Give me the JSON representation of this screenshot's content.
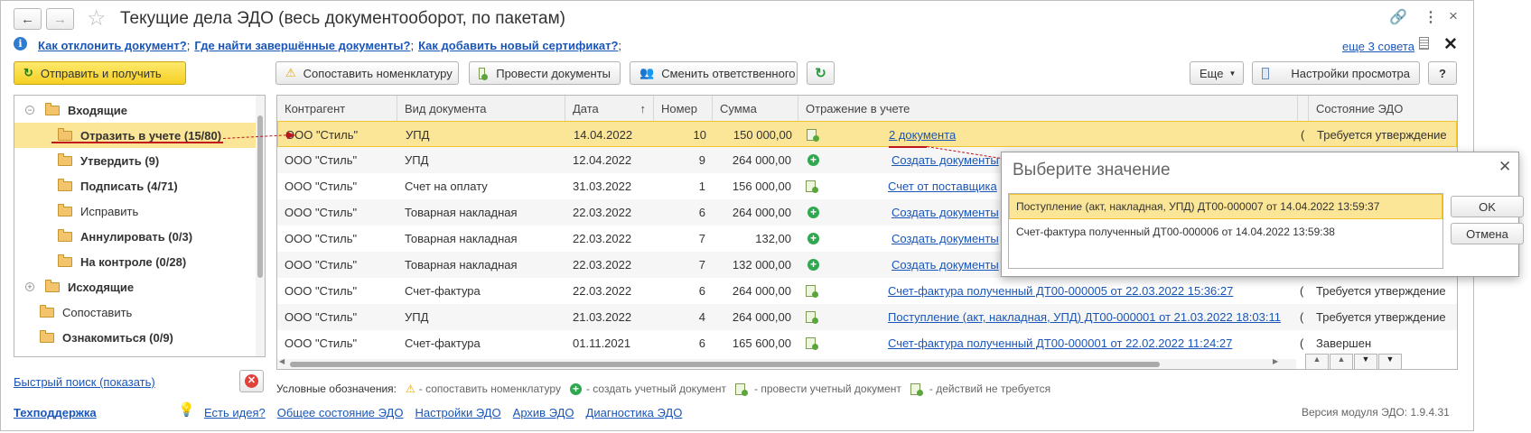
{
  "window": {
    "title": "Текущие дела ЭДО (весь документооборот, по пакетам)"
  },
  "help_links": [
    "Как отклонить документ?",
    "Где найти завершённые документы?",
    "Как добавить новый сертификат?"
  ],
  "help_separator": ";",
  "more_tips": "еще 3 совета",
  "toolbar": {
    "send_receive": "Отправить и получить",
    "match_nomenclature": "Сопоставить номенклатуру",
    "post_documents": "Провести документы",
    "change_responsible": "Сменить ответственного",
    "more": "Еще",
    "view_settings": "Настройки просмотра",
    "help": "?"
  },
  "tree": {
    "incoming": "Входящие",
    "items": [
      {
        "label": "Отразить в учете (15/80)",
        "bold": true
      },
      {
        "label": "Утвердить (9)",
        "bold": true
      },
      {
        "label": "Подписать (4/71)",
        "bold": true
      },
      {
        "label": "Исправить",
        "bold": false
      },
      {
        "label": "Аннулировать (0/3)",
        "bold": true
      },
      {
        "label": "На контроле (0/28)",
        "bold": true
      }
    ],
    "outgoing": "Исходящие",
    "match": "Сопоставить",
    "review": "Ознакомиться (0/9)"
  },
  "quick_search": "Быстрый поиск (показать)",
  "table": {
    "columns": [
      "Контрагент",
      "Вид документа",
      "Дата",
      "Номер",
      "Сумма",
      "Отражение в учете",
      "",
      "Состояние ЭДО"
    ],
    "sort_indicator": "↑",
    "rows": [
      {
        "counterparty": "ООО \"Стиль\"",
        "doc_type": "УПД",
        "date": "14.04.2022",
        "number": "10",
        "sum": "150 000,00",
        "icon": "doc",
        "accounting": "2 документа",
        "c": "(",
        "status": "Требуется утверждение"
      },
      {
        "counterparty": "ООО \"Стиль\"",
        "doc_type": "УПД",
        "date": "12.04.2022",
        "number": "9",
        "sum": "264 000,00",
        "icon": "plus",
        "accounting": "Создать документы",
        "c": "",
        "status": ""
      },
      {
        "counterparty": "ООО \"Стиль\"",
        "doc_type": "Счет на оплату",
        "date": "31.03.2022",
        "number": "1",
        "sum": "156 000,00",
        "icon": "doc",
        "accounting": "Счет от поставщика",
        "c": "",
        "status": ""
      },
      {
        "counterparty": "ООО \"Стиль\"",
        "doc_type": "Товарная накладная",
        "date": "22.03.2022",
        "number": "6",
        "sum": "264 000,00",
        "icon": "plus",
        "accounting": "Создать документы",
        "c": "",
        "status": ""
      },
      {
        "counterparty": "ООО \"Стиль\"",
        "doc_type": "Товарная накладная",
        "date": "22.03.2022",
        "number": "7",
        "sum": "132,00",
        "icon": "plus",
        "accounting": "Создать документы",
        "c": "",
        "status": ""
      },
      {
        "counterparty": "ООО \"Стиль\"",
        "doc_type": "Товарная накладная",
        "date": "22.03.2022",
        "number": "7",
        "sum": "132 000,00",
        "icon": "plus",
        "accounting": "Создать документы",
        "c": "",
        "status": ""
      },
      {
        "counterparty": "ООО \"Стиль\"",
        "doc_type": "Счет-фактура",
        "date": "22.03.2022",
        "number": "6",
        "sum": "264 000,00",
        "icon": "doc",
        "accounting": "Счет-фактура полученный ДТ00-000005 от 22.03.2022 15:36:27",
        "c": "(",
        "status": "Требуется утверждение"
      },
      {
        "counterparty": "ООО \"Стиль\"",
        "doc_type": "УПД",
        "date": "21.03.2022",
        "number": "4",
        "sum": "264 000,00",
        "icon": "doc",
        "accounting": "Поступление (акт, накладная, УПД) ДТ00-000001 от 21.03.2022 18:03:11",
        "c": "(",
        "status": "Требуется утверждение"
      },
      {
        "counterparty": "ООО \"Стиль\"",
        "doc_type": "Счет-фактура",
        "date": "01.11.2021",
        "number": "6",
        "sum": "165 600,00",
        "icon": "doc",
        "accounting": "Счет-фактура полученный ДТ00-000001 от 22.02.2022 11:24:27",
        "c": "(",
        "status": "Завершен"
      }
    ]
  },
  "legend": {
    "title": "Условные обозначения:",
    "items": [
      "- сопоставить номенклатуру",
      "- создать учетный документ",
      "- провести учетный документ",
      "- действий не требуется"
    ]
  },
  "footer": {
    "support": "Техподдержка",
    "links": [
      "Есть идея?",
      "Общее состояние ЭДО",
      "Настройки ЭДО",
      "Архив ЭДО",
      "Диагностика ЭДО"
    ],
    "version": "Версия модуля ЭДО: 1.9.4.31"
  },
  "popup": {
    "title": "Выберите значение",
    "options": [
      "Поступление (акт, накладная, УПД) ДТ00-000007 от 14.04.2022 13:59:37",
      "Счет-фактура полученный ДТ00-000006 от 14.04.2022 13:59:38"
    ],
    "ok": "OK",
    "cancel": "Отмена"
  },
  "colors": {
    "selected_row": "#fbe597",
    "link": "#1a56b8",
    "accent_yellow": "#f5cf23",
    "arrow": "#c0161c"
  }
}
